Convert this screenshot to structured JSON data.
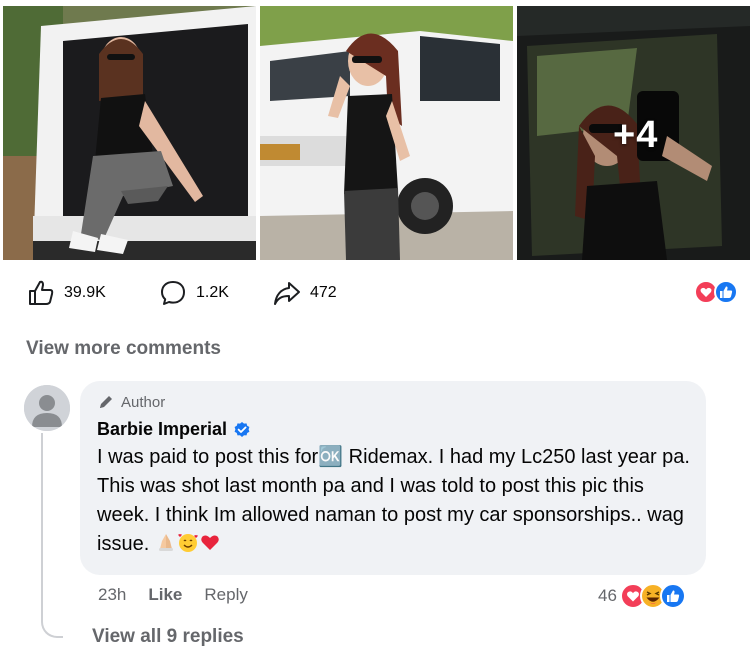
{
  "post": {
    "photos": [
      {
        "description_icon": "photo-woman-sitting-in-suv-trunk"
      },
      {
        "description_icon": "photo-woman-standing-by-white-suv"
      },
      {
        "description_icon": "photo-woman-mirror-selfie"
      }
    ],
    "more_photos_label": "+4",
    "likes_count": "39.9K",
    "comments_count": "1.2K",
    "shares_count": "472",
    "icons": {
      "like": "thumbs-up-icon",
      "comment": "comment-bubble-icon",
      "share": "share-arrow-icon",
      "reactions": [
        "love-reaction-icon",
        "like-reaction-icon"
      ]
    }
  },
  "comments": {
    "view_more_label": "View more comments",
    "items": [
      {
        "author_badge": "Author",
        "name": "Barbie Imperial",
        "verified": true,
        "text": "I was paid to post this for🆗 Ridemax. I had my Lc250 last year pa. This was shot last month pa and I was told to post this pic this week. I think Im allowed naman to post my car sponsorships.. wag issue. ",
        "emojis": [
          "folded-hands-emoji",
          "smiling-face-with-hearts-emoji",
          "red-heart-emoji"
        ],
        "time": "23h",
        "like_label": "Like",
        "reply_label": "Reply",
        "reaction_count": "46",
        "reaction_icons": [
          "love-reaction-icon",
          "haha-reaction-icon",
          "like-reaction-icon"
        ],
        "view_replies_label": "View all 9 replies"
      }
    ]
  },
  "colors": {
    "facebook_blue": "#1877f2",
    "love_red": "#f33e58",
    "haha_yellow": "#f7b125",
    "muted_text": "#65676b",
    "bubble_bg": "#f0f2f5"
  }
}
